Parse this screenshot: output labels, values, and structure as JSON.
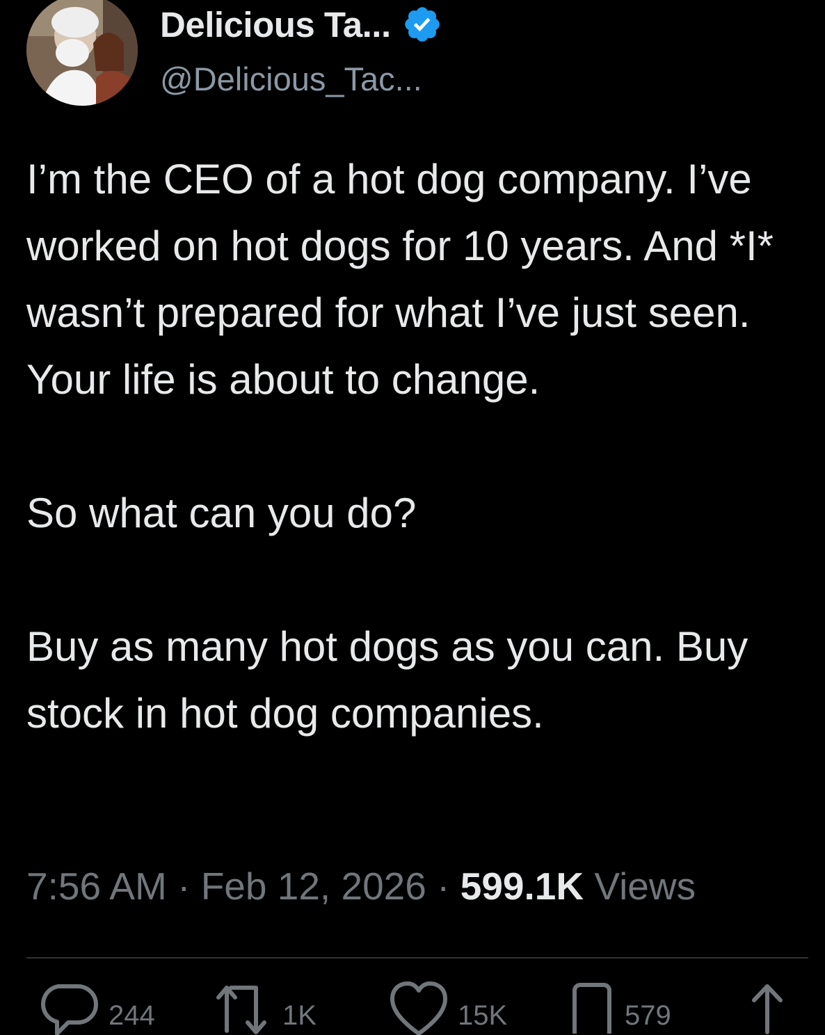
{
  "author": {
    "display_name": "Delicious Ta...",
    "handle": "@Delicious_Tac...",
    "verified": true
  },
  "tweet": {
    "paragraphs": [
      "I’m the CEO of a hot dog company. I’ve worked on hot dogs for 10 years. And *I* wasn’t prepared for what I’ve just seen. Your life is about to change.",
      "So what can you do?",
      "Buy as many hot dogs as you can. Buy stock in hot dog companies."
    ]
  },
  "meta": {
    "time": "7:56 AM",
    "separator": "·",
    "date": "Feb 12, 2026",
    "views_count": "599.1K",
    "views_label": "Views"
  },
  "actions": {
    "replies": "244",
    "reposts": "1K",
    "likes": "15K",
    "bookmarks": "579"
  },
  "colors": {
    "background": "#000000",
    "text_primary": "#e7e9ea",
    "text_secondary": "#71767b",
    "verified_blue": "#1d9bf0",
    "divider": "#2f3336"
  }
}
